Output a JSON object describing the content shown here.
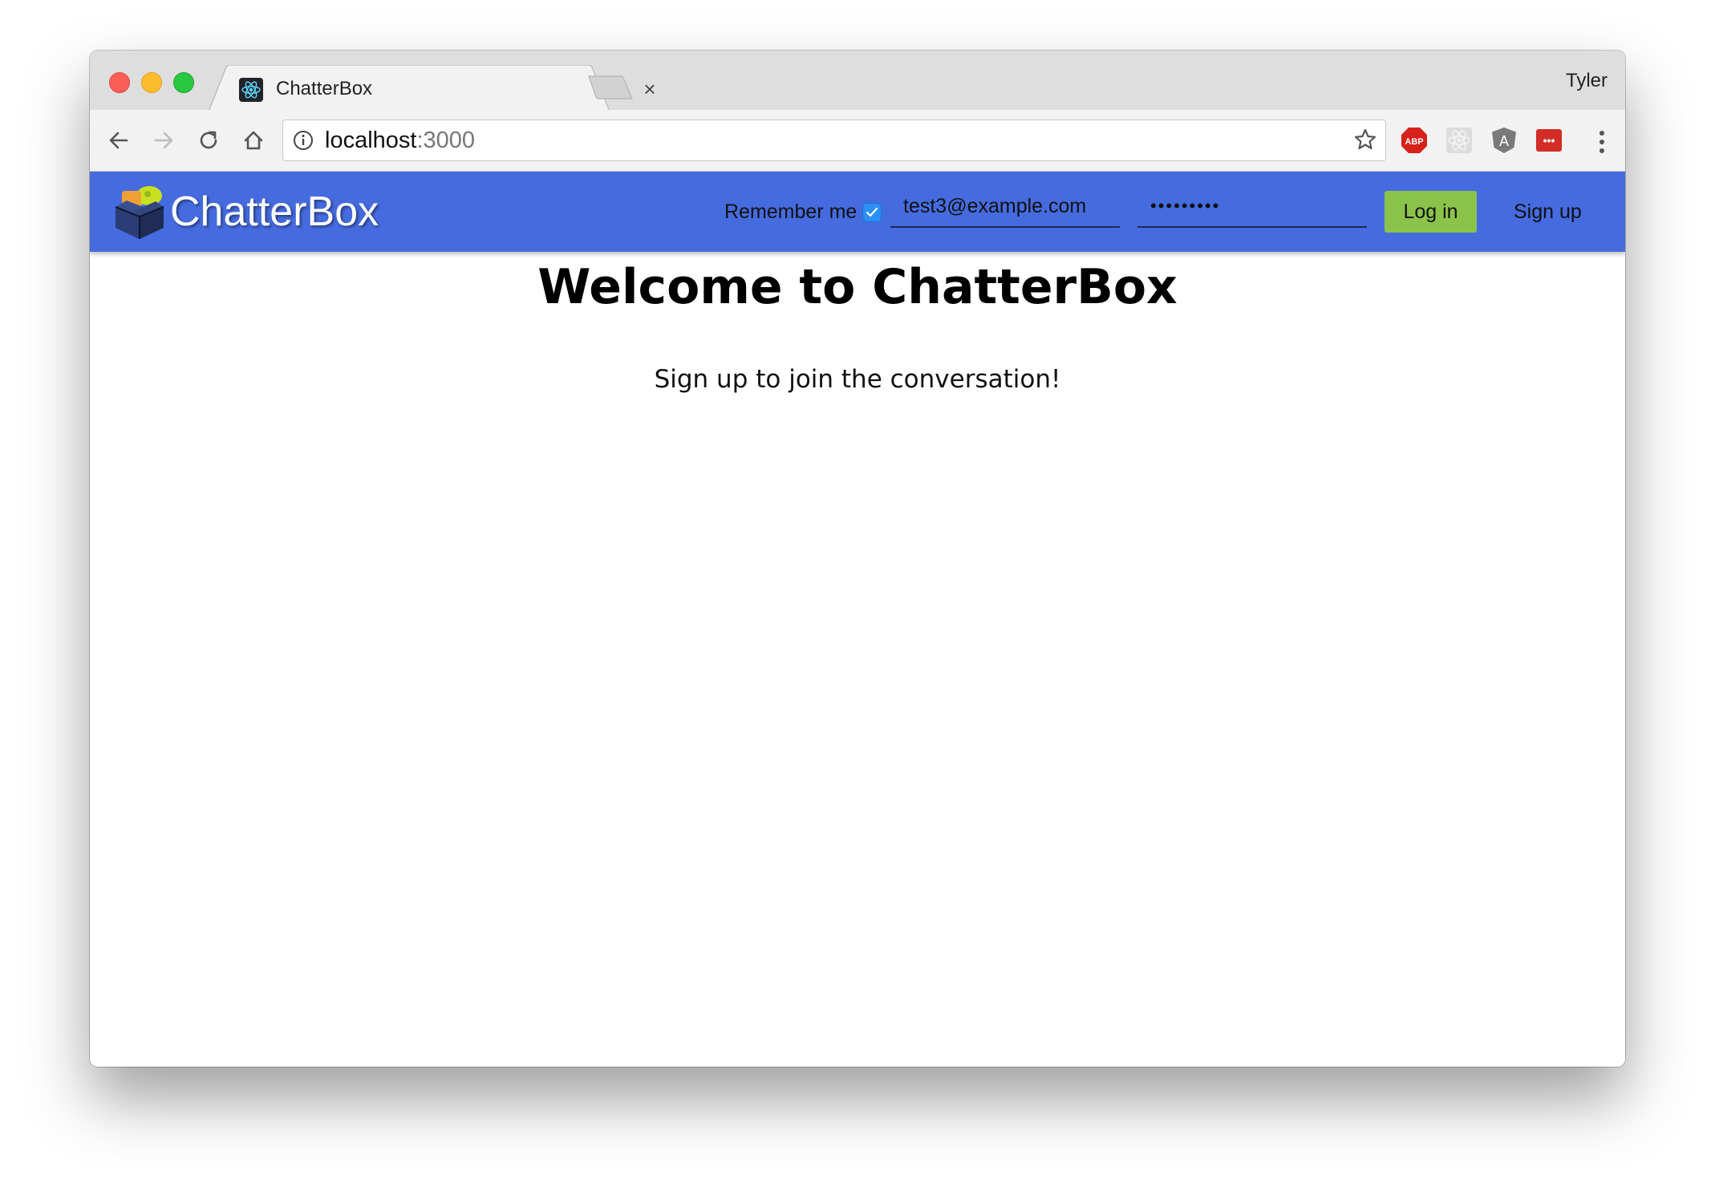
{
  "browser": {
    "tab_title": "ChatterBox",
    "tab_close": "×",
    "profile_name": "Tyler",
    "address_host": "localhost",
    "address_port": ":3000",
    "icons": [
      "back-icon",
      "forward-icon",
      "reload-icon",
      "home-icon",
      "info-icon",
      "bookmark-star-icon",
      "adblock-plus-icon",
      "react-devtools-icon",
      "angular-icon",
      "lastpass-icon",
      "menu-icon"
    ],
    "extensions": {
      "abp_label": "ABP",
      "angular_label": "A",
      "lastpass_label": "•••"
    }
  },
  "app": {
    "brand": "ChatterBox",
    "navbar": {
      "remember_label": "Remember me",
      "remember_checked": true,
      "email_value": "test3@example.com",
      "password_value": "•••••••••",
      "login_label": "Log in",
      "signup_label": "Sign up"
    },
    "main": {
      "heading": "Welcome to ChatterBox",
      "subheading": "Sign up to join the conversation!"
    }
  },
  "colors": {
    "navbar_bg": "#456bdf",
    "login_button": "#8bc34a",
    "checkbox": "#2b8ff7"
  }
}
